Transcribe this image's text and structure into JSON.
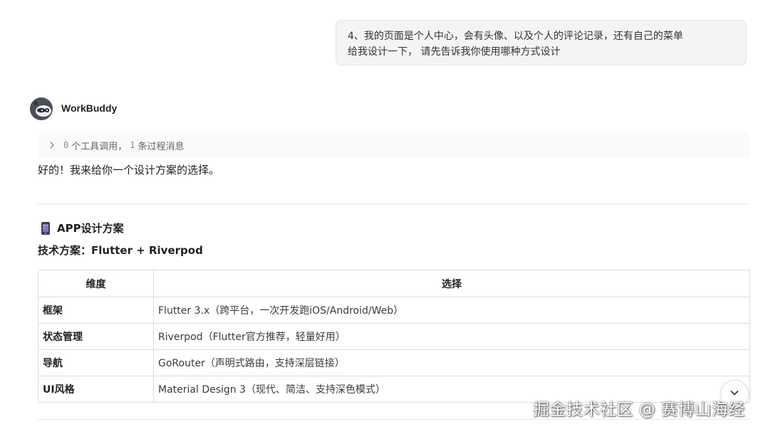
{
  "user_message": {
    "line1": "4、我的页面是个人中心，会有头像、以及个人的评论记录，还有自己的菜单",
    "line2": "给我设计一下， 请先告诉我你使用哪种方式设计"
  },
  "assistant": {
    "name": "WorkBuddy",
    "tool_summary": {
      "tool_count": "0",
      "tool_label": "个工具调用，",
      "process_count": "1",
      "process_label": "条过程消息"
    },
    "reply": "好的！我来给你一个设计方案的选择。"
  },
  "plan": {
    "heading": "APP设计方案",
    "tech": "技术方案：Flutter + Riverpod",
    "table": {
      "headers": [
        "维度",
        "选择"
      ],
      "rows": [
        {
          "dim": "框架",
          "val": "Flutter 3.x（跨平台，一次开发跑iOS/Android/Web）"
        },
        {
          "dim": "状态管理",
          "val": "Riverpod（Flutter官方推荐，轻量好用）"
        },
        {
          "dim": "导航",
          "val": "GoRouter（声明式路由，支持深层链接）"
        },
        {
          "dim": "UI风格",
          "val": "Material Design 3（现代、简洁、支持深色模式）"
        }
      ]
    }
  },
  "watermark": "掘金技术社区 @ 赛博山海经",
  "icons": {
    "avatar": "raccoon-avatar-icon",
    "expand": "chevron-right-icon",
    "plan": "mobile-phone-icon",
    "scroll": "chevron-down-icon"
  },
  "colors": {
    "bubble_bg": "#f4f4f5",
    "avatar_bg": "#4a4f5c",
    "table_border": "#dcdcdc"
  }
}
